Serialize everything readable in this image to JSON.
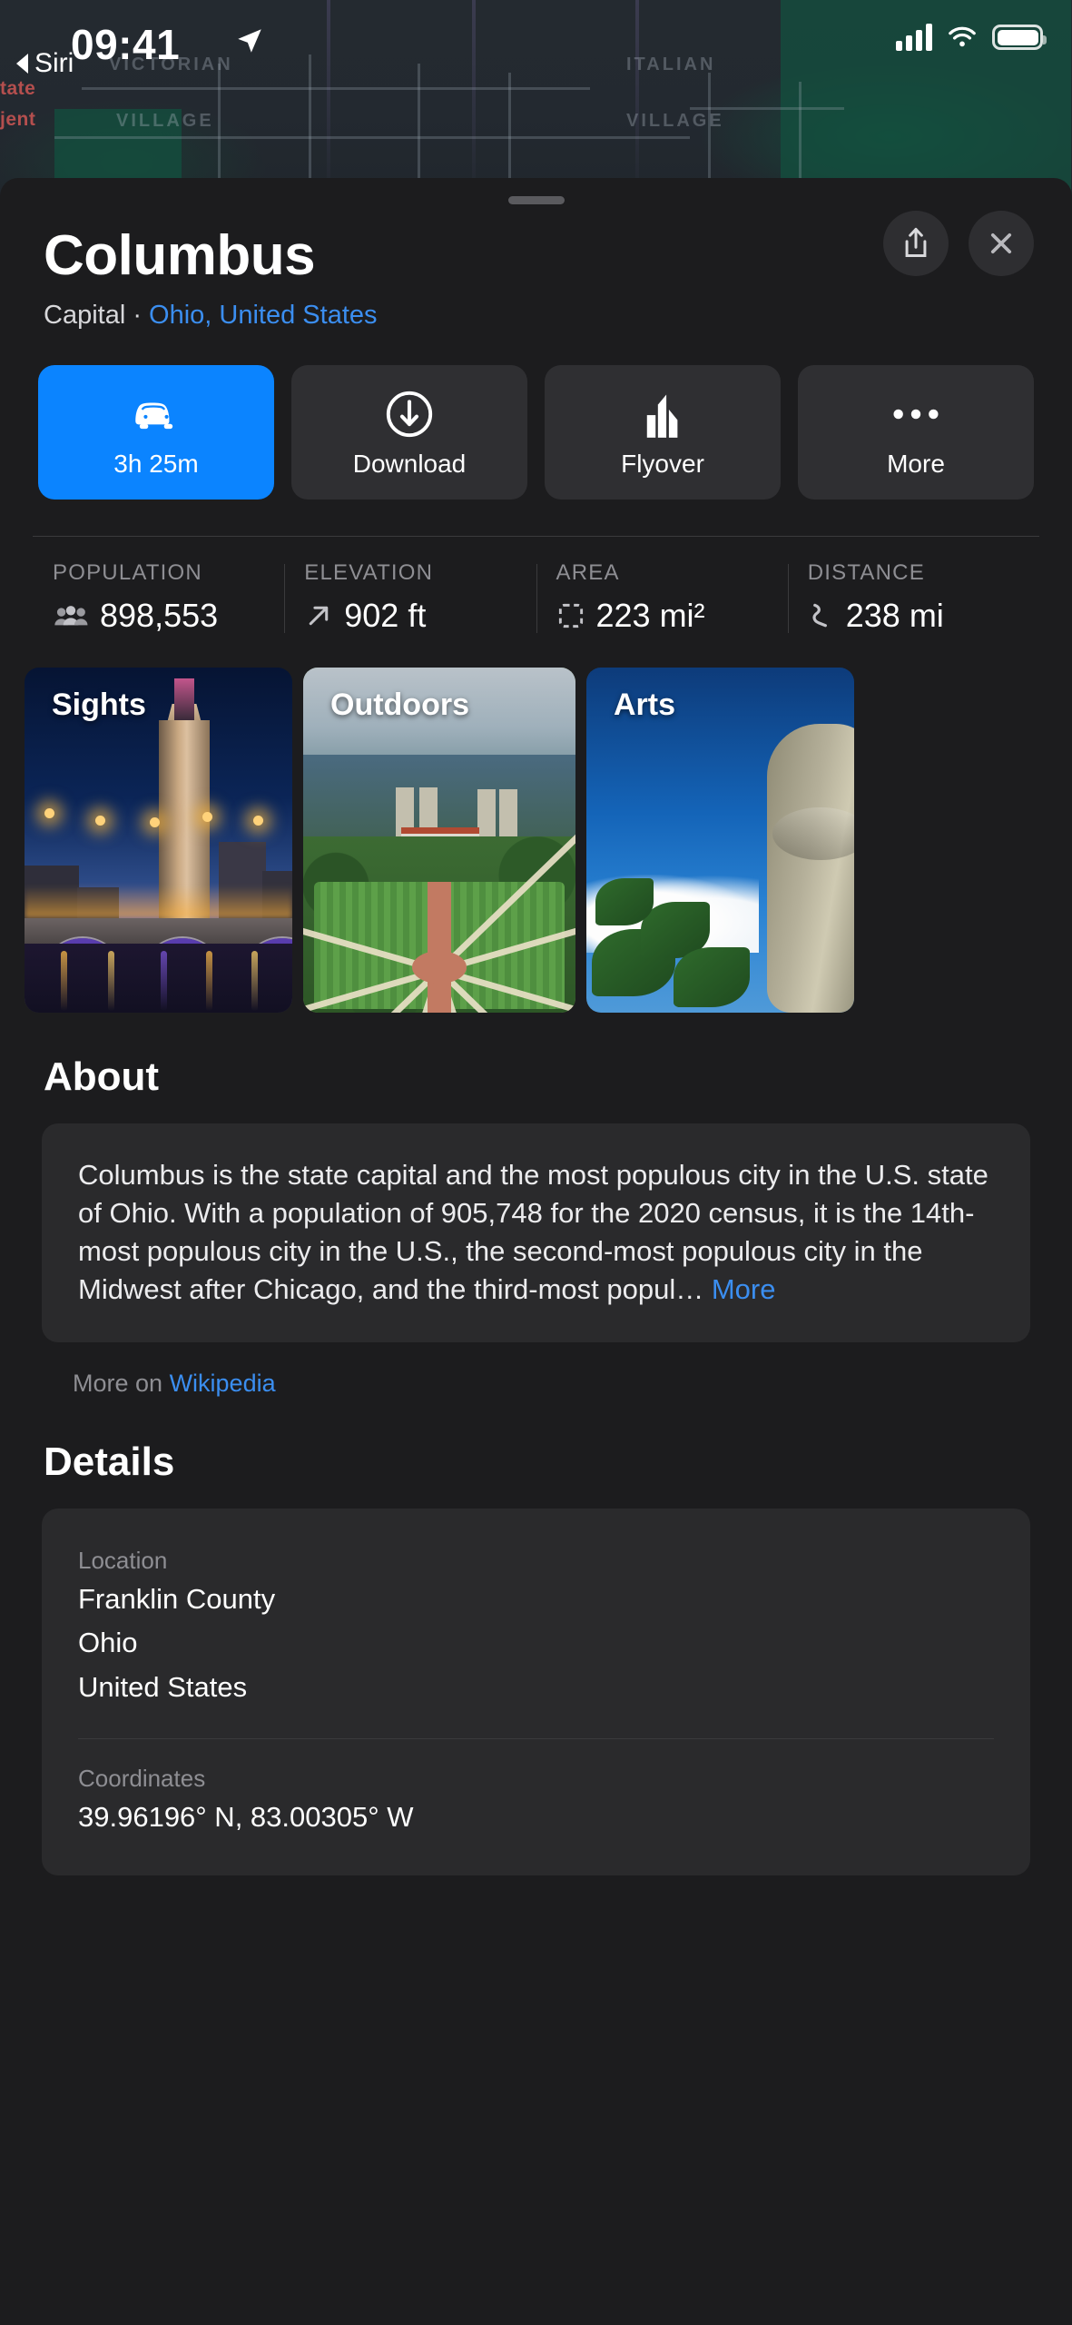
{
  "status_bar": {
    "time": "09:41",
    "back_app_label": "Siri",
    "location_arrow_icon": "location-arrow-icon",
    "signal_icon": "cellular-signal-icon",
    "wifi_icon": "wifi-icon",
    "battery_icon": "battery-icon"
  },
  "map": {
    "labels": [
      "VICTORIAN",
      "VILLAGE",
      "ITALIAN",
      "VILLAGE"
    ],
    "red_labels": [
      "tate",
      "jent"
    ]
  },
  "header": {
    "title": "Columbus",
    "subtitle_prefix": "Capital · ",
    "subtitle_link": "Ohio, United States",
    "share_icon": "share-icon",
    "close_icon": "close-icon"
  },
  "actions": [
    {
      "label": "3h 25m",
      "icon": "car-icon",
      "primary": true
    },
    {
      "label": "Download",
      "icon": "download-circle-icon",
      "primary": false
    },
    {
      "label": "Flyover",
      "icon": "buildings-icon",
      "primary": false
    },
    {
      "label": "More",
      "icon": "ellipsis-icon",
      "primary": false
    }
  ],
  "stats": [
    {
      "label": "POPULATION",
      "value": "898,553",
      "icon": "people-icon"
    },
    {
      "label": "ELEVATION",
      "value": "902 ft",
      "icon": "arrow-up-right-icon"
    },
    {
      "label": "AREA",
      "value": "223 mi²",
      "icon": "dashed-square-icon"
    },
    {
      "label": "DISTANCE",
      "value": "238 mi",
      "icon": "winding-road-icon"
    }
  ],
  "cards": [
    {
      "title": "Sights"
    },
    {
      "title": "Outdoors"
    },
    {
      "title": "Arts"
    }
  ],
  "about": {
    "heading": "About",
    "body": "Columbus is the state capital and the most populous city in the U.S. state of Ohio. With a population of 905,748 for the 2020 census, it is the 14th-most populous city in the U.S., the second-most populous city in the Midwest after Chicago, and the third-most popul… ",
    "more_label": "More",
    "wiki_prefix": "More on ",
    "wiki_link": "Wikipedia"
  },
  "details": {
    "heading": "Details",
    "location_label": "Location",
    "location_lines": [
      "Franklin County",
      "Ohio",
      "United States"
    ],
    "coordinates_label": "Coordinates",
    "coordinates_value": "39.96196° N, 83.00305° W"
  },
  "colors": {
    "accent_blue": "#0b84ff",
    "link_blue": "#3b8ef0",
    "sheet_bg": "#1c1c1e",
    "panel_bg": "#2a2a2c",
    "secondary_text": "#8e8e93"
  }
}
